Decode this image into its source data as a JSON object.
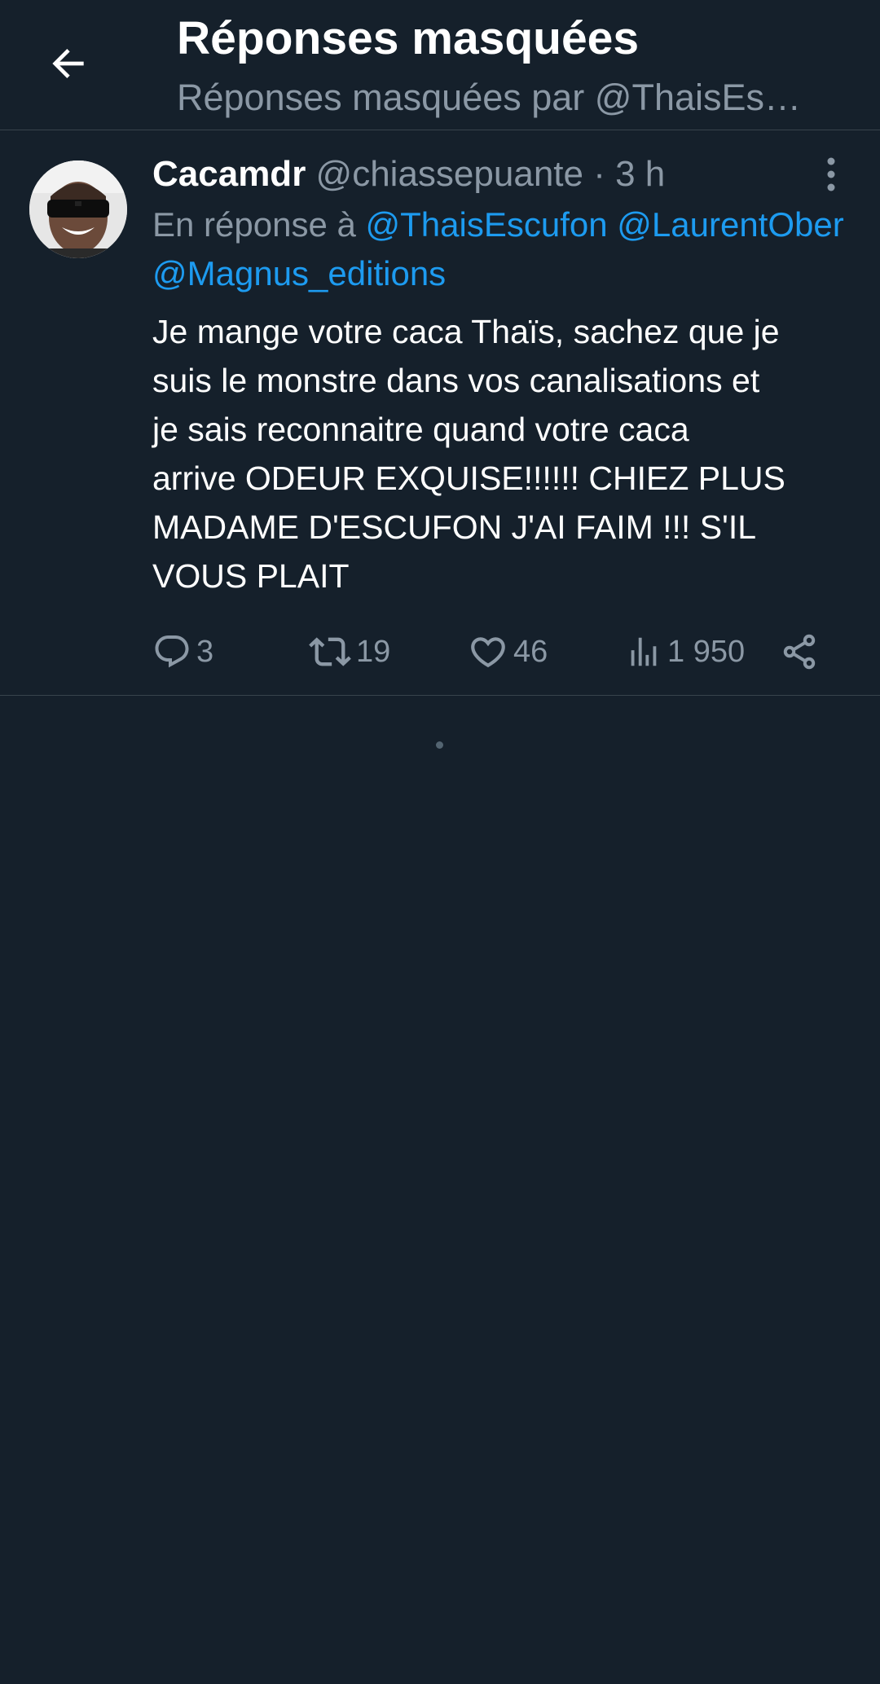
{
  "header": {
    "title": "Réponses masquées",
    "subtitle": "Réponses masquées par @ThaisEs…"
  },
  "tweet": {
    "author_name": "Cacamdr",
    "author_handle": "@chiassepuante",
    "separator": " · ",
    "time": "3 h",
    "reply_prefix": "En réponse à ",
    "mentions": [
      "@ThaisEscufon",
      "@LaurentOber",
      "@Magnus_editions"
    ],
    "text_lines": [
      "Je mange votre caca Thaïs, sachez que je",
      "suis le monstre dans vos canalisations et",
      "je sais reconnaitre quand votre caca",
      "arrive ODEUR EXQUISE!!!!!! CHIEZ PLUS",
      "MADAME D'ESCUFON J'AI FAIM !!! S'IL",
      "VOUS PLAIT"
    ],
    "stats": {
      "replies": "3",
      "retweets": "19",
      "likes": "46",
      "views": "1 950"
    }
  },
  "icons": {
    "back": "arrow-left-icon",
    "more": "more-vertical-icon",
    "reply": "reply-icon",
    "retweet": "retweet-icon",
    "like": "heart-icon",
    "views": "analytics-icon",
    "share": "share-icon"
  },
  "colors": {
    "background": "#15202b",
    "divider": "#38444d",
    "text_primary": "#ffffff",
    "text_secondary": "#8b98a5",
    "accent": "#1d9bf0"
  }
}
